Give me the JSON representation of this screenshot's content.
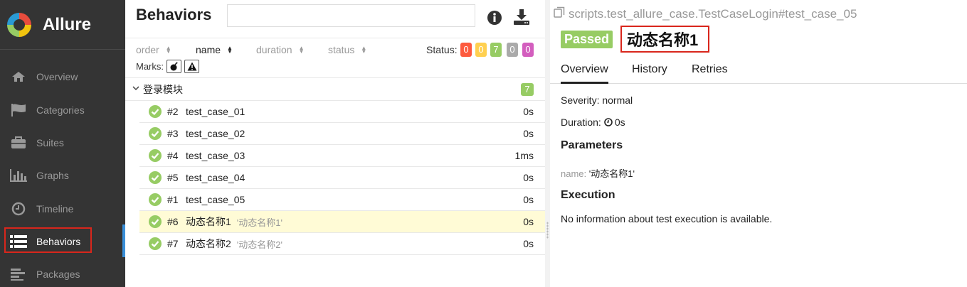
{
  "brand": {
    "name": "Allure"
  },
  "sidebar": {
    "items": [
      {
        "label": "Overview",
        "icon": "home-icon"
      },
      {
        "label": "Categories",
        "icon": "flag-icon"
      },
      {
        "label": "Suites",
        "icon": "briefcase-icon"
      },
      {
        "label": "Graphs",
        "icon": "bar-chart-icon"
      },
      {
        "label": "Timeline",
        "icon": "clock-icon"
      },
      {
        "label": "Behaviors",
        "icon": "list-icon"
      },
      {
        "label": "Packages",
        "icon": "align-left-icon"
      }
    ],
    "active_item": "Behaviors"
  },
  "behaviors": {
    "title": "Behaviors",
    "search_value": "",
    "sort": {
      "order": "order",
      "name": "name",
      "duration": "duration",
      "status": "status"
    },
    "status_label": "Status:",
    "status_counts": [
      {
        "value": "0",
        "color": "#fd5a3e"
      },
      {
        "value": "0",
        "color": "#ffd050"
      },
      {
        "value": "7",
        "color": "#97cc64"
      },
      {
        "value": "0",
        "color": "#aaaaaa"
      },
      {
        "value": "0",
        "color": "#d35ebe"
      }
    ],
    "marks_label": "Marks:",
    "group": {
      "name": "登录模块",
      "count": "7"
    },
    "rows": [
      {
        "order": "#2",
        "name": "test_case_01",
        "param": "",
        "duration": "0s"
      },
      {
        "order": "#3",
        "name": "test_case_02",
        "param": "",
        "duration": "0s"
      },
      {
        "order": "#4",
        "name": "test_case_03",
        "param": "",
        "duration": "1ms"
      },
      {
        "order": "#5",
        "name": "test_case_04",
        "param": "",
        "duration": "0s"
      },
      {
        "order": "#1",
        "name": "test_case_05",
        "param": "",
        "duration": "0s"
      },
      {
        "order": "#6",
        "name": "动态名称1",
        "param": "'动态名称1'",
        "duration": "0s"
      },
      {
        "order": "#7",
        "name": "动态名称2",
        "param": "'动态名称2'",
        "duration": "0s"
      }
    ]
  },
  "detail": {
    "path": "scripts.test_allure_case.TestCaseLogin#test_case_05",
    "status": "Passed",
    "title": "动态名称1",
    "tabs": [
      "Overview",
      "History",
      "Retries"
    ],
    "severity": "Severity: normal",
    "duration_label": "Duration:",
    "duration_value": "0s",
    "parameters_heading": "Parameters",
    "param_name": "name:",
    "param_value": "'动态名称1'",
    "execution_heading": "Execution",
    "execution_text": "No information about test execution is available."
  }
}
